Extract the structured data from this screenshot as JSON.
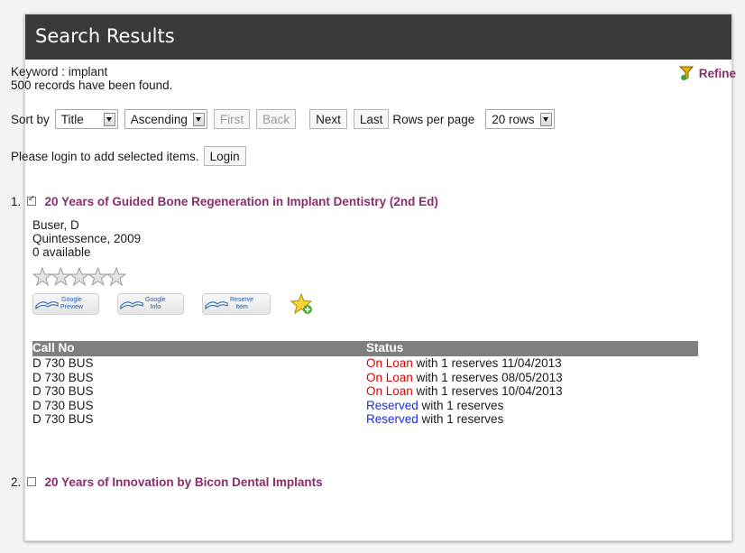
{
  "header": {
    "title": "Search Results"
  },
  "query": {
    "keyword_line": "Keyword : implant",
    "found_line": "500 records have been found.",
    "refine_label": "Refine"
  },
  "sort": {
    "label": "Sort by",
    "field_value": "Title",
    "order_value": "Ascending",
    "first_label": "First",
    "back_label": "Back",
    "next_label": "Next",
    "last_label": "Last",
    "rows_label": "Rows per page",
    "rows_value": "20 rows"
  },
  "login": {
    "message": "Please login to add selected items.",
    "button": "Login"
  },
  "results": [
    {
      "number": "1.",
      "checked": true,
      "title": "20 Years of Guided Bone Regeneration in Implant Dentistry (2nd Ed)",
      "author": "Buser, D",
      "publisher": "Quintessence, 2009",
      "availability": "0 available",
      "rating_stars": 5,
      "buttons": [
        {
          "line1": "Google",
          "line2": "Preview"
        },
        {
          "line1": "Google",
          "line2": "Info"
        },
        {
          "line1": "Reserve",
          "line2": "Item"
        }
      ],
      "table": {
        "headers": [
          "Call No",
          "Status"
        ],
        "rows": [
          {
            "call_no": "D 730 BUS",
            "status_word": "On Loan",
            "status_rest": " with 1 reserves 11/04/2013"
          },
          {
            "call_no": "D 730 BUS",
            "status_word": "On Loan",
            "status_rest": " with 1 reserves 08/05/2013"
          },
          {
            "call_no": "D 730 BUS",
            "status_word": "On Loan",
            "status_rest": " with 1 reserves 10/04/2013"
          },
          {
            "call_no": "D 730 BUS",
            "status_word": "Reserved",
            "status_rest": " with 1 reserves"
          },
          {
            "call_no": "D 730 BUS",
            "status_word": "Reserved",
            "status_rest": " with 1 reserves"
          }
        ]
      }
    },
    {
      "number": "2.",
      "checked": false,
      "title": "20 Years of Innovation by Bicon Dental Implants"
    }
  ],
  "colors": {
    "header_bg": "#3a3a3a",
    "title": "#8b2d6b",
    "on_loan": "#e60000",
    "reserved": "#1a2de0"
  },
  "icons": [
    "filter-icon",
    "star-rating-icon",
    "google-preview-icon",
    "google-info-icon",
    "reserve-item-icon",
    "add-favorite-icon",
    "dropdown-arrow-icon"
  ]
}
